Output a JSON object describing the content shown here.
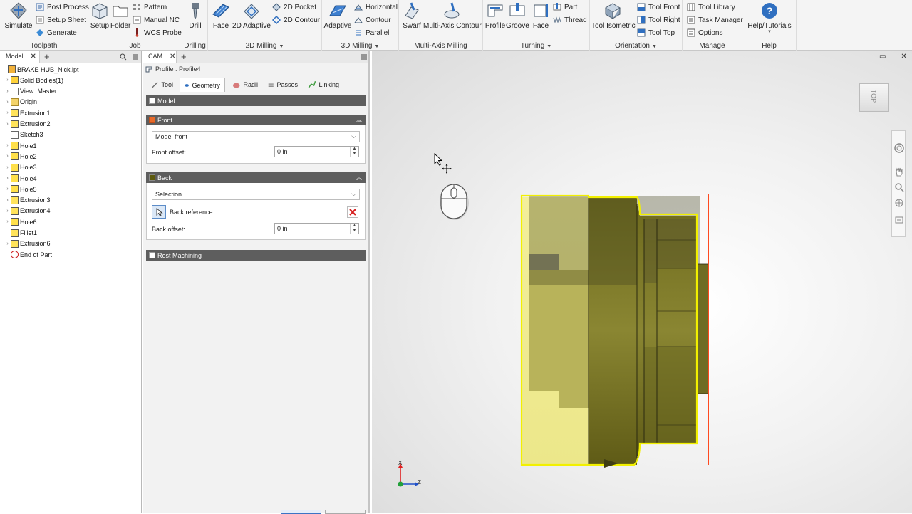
{
  "ribbon": {
    "toolpath": {
      "label": "Toolpath",
      "simulate": "Simulate",
      "post_process": "Post Process",
      "setup_sheet": "Setup Sheet",
      "generate": "Generate"
    },
    "job": {
      "label": "Job",
      "setup": "Setup",
      "folder": "Folder",
      "pattern": "Pattern",
      "manual_nc": "Manual NC",
      "wcs_probe": "WCS Probe"
    },
    "drilling": {
      "label": "Drilling",
      "drill": "Drill"
    },
    "milling_2d": {
      "label": "2D Milling",
      "face": "Face",
      "adaptive_2d": "2D Adaptive",
      "pocket_2d": "2D Pocket",
      "contour_2d": "2D Contour"
    },
    "milling_3d": {
      "label": "3D Milling",
      "adaptive": "Adaptive",
      "horizontal": "Horizontal",
      "contour": "Contour",
      "parallel": "Parallel"
    },
    "multi_axis": {
      "label": "Multi-Axis Milling",
      "swarf": "Swarf",
      "multi_axis_contour": "Multi-Axis Contour"
    },
    "turning": {
      "label": "Turning",
      "profile": "Profile",
      "groove": "Groove",
      "face": "Face",
      "part": "Part",
      "thread": "Thread"
    },
    "orientation": {
      "label": "Orientation",
      "tool_isometric": "Tool Isometric",
      "tool_front": "Tool Front",
      "tool_right": "Tool Right",
      "tool_top": "Tool Top"
    },
    "manage": {
      "label": "Manage",
      "tool_library": "Tool Library",
      "task_manager": "Task Manager",
      "options": "Options"
    },
    "help": {
      "label": "Help",
      "help_tutorials": "Help/Tutorials"
    }
  },
  "model_browser": {
    "tab_label": "Model",
    "items": [
      {
        "label": "BRAKE HUB_Nick.ipt"
      },
      {
        "label": "Solid Bodies(1)"
      },
      {
        "label": "View: Master"
      },
      {
        "label": "Origin"
      },
      {
        "label": "Extrusion1"
      },
      {
        "label": "Extrusion2"
      },
      {
        "label": "Sketch3"
      },
      {
        "label": "Hole1"
      },
      {
        "label": "Hole2"
      },
      {
        "label": "Hole3"
      },
      {
        "label": "Hole4"
      },
      {
        "label": "Hole5"
      },
      {
        "label": "Extrusion3"
      },
      {
        "label": "Extrusion4"
      },
      {
        "label": "Hole6"
      },
      {
        "label": "Fillet1"
      },
      {
        "label": "Extrusion6"
      },
      {
        "label": "End of Part"
      }
    ]
  },
  "cam_panel": {
    "tab_label": "CAM",
    "breadcrumb": "Profile : Profile4",
    "tabs": [
      {
        "label": "Tool"
      },
      {
        "label": "Geometry"
      },
      {
        "label": "Radii"
      },
      {
        "label": "Passes"
      },
      {
        "label": "Linking"
      }
    ],
    "sections": {
      "model": "Model",
      "front": "Front",
      "back": "Back",
      "rest_machining": "Rest Machining"
    },
    "front": {
      "mode": "Model front",
      "offset_label": "Front offset:",
      "offset_value": "0 in"
    },
    "back": {
      "mode": "Selection",
      "reference_label": "Back reference",
      "offset_label": "Back offset:",
      "offset_value": "0 in"
    }
  },
  "viewport": {
    "viewcube_label": "TOP",
    "triad": {
      "x": "X",
      "z": "Z"
    },
    "colors": {
      "part_shadow": "#505015",
      "part_olive": "#7d7a28",
      "part_highlight": "#f3ef85",
      "selection_outline": "#f2f000",
      "back_plane": "#ff4a20"
    }
  },
  "colors": {
    "ribbon_bg": "#f4f4f4",
    "panel_header": "#5e5e5e",
    "accent_blue": "#2f6fc0"
  }
}
